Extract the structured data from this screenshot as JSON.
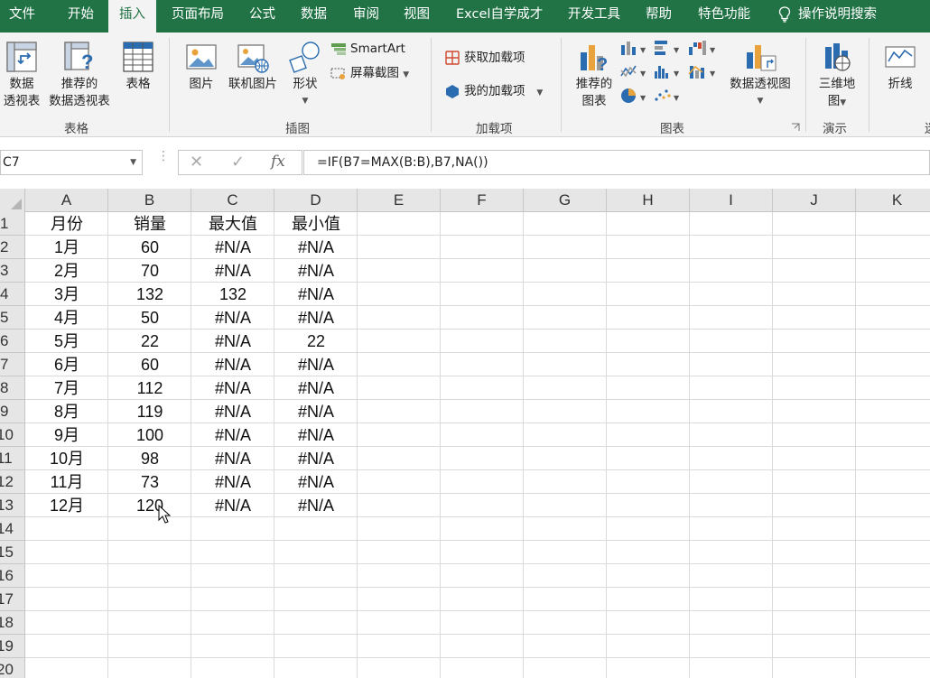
{
  "tabs": [
    {
      "label": "文件"
    },
    {
      "label": "开始"
    },
    {
      "label": "插入"
    },
    {
      "label": "页面布局"
    },
    {
      "label": "公式"
    },
    {
      "label": "数据"
    },
    {
      "label": "审阅"
    },
    {
      "label": "视图"
    },
    {
      "label": "Excel自学成才"
    },
    {
      "label": "开发工具"
    },
    {
      "label": "帮助"
    },
    {
      "label": "特色功能"
    },
    {
      "label": "操作说明搜索"
    }
  ],
  "active_tab": "插入",
  "ribbon": {
    "tables": {
      "pivot_line1": "数据",
      "pivot_line2": "透视表",
      "rec_pivot_line1": "推荐的",
      "rec_pivot_line2": "数据透视表",
      "table": "表格",
      "group": "表格"
    },
    "illustrations": {
      "pictures": "图片",
      "online_pictures": "联机图片",
      "shapes": "形状",
      "smartart": "SmartArt",
      "screenshot": "屏幕截图",
      "group": "插图"
    },
    "addins": {
      "get_addins": "获取加载项",
      "my_addins": "我的加载项",
      "group": "加载项"
    },
    "charts": {
      "rec_charts_line1": "推荐的",
      "rec_charts_line2": "图表",
      "pivot_chart": "数据透视图",
      "group": "图表"
    },
    "tours": {
      "map3d_line1": "三维地",
      "map3d_line2": "图",
      "group": "演示"
    },
    "sparklines": {
      "line": "折线",
      "group_partial": "迷"
    }
  },
  "formula_bar": {
    "name_box": "C7",
    "cancel_symbol": "✕",
    "enter_symbol": "✓",
    "fx_symbol": "fx",
    "formula": "=IF(B7=MAX(B:B),B7,NA())"
  },
  "columns": [
    "A",
    "B",
    "C",
    "D",
    "E",
    "F",
    "G",
    "H",
    "I",
    "J",
    "K"
  ],
  "row_numbers": [
    "1",
    "2",
    "3",
    "4",
    "5",
    "6",
    "7",
    "8",
    "9",
    "10",
    "11",
    "12",
    "13",
    "14",
    "15",
    "16",
    "17",
    "18",
    "19",
    "20"
  ],
  "sheet_rows": [
    [
      "月份",
      "销量",
      "最大值",
      "最小值"
    ],
    [
      "1月",
      "60",
      "#N/A",
      "#N/A"
    ],
    [
      "2月",
      "70",
      "#N/A",
      "#N/A"
    ],
    [
      "3月",
      "132",
      "132",
      "#N/A"
    ],
    [
      "4月",
      "50",
      "#N/A",
      "#N/A"
    ],
    [
      "5月",
      "22",
      "#N/A",
      "22"
    ],
    [
      "6月",
      "60",
      "#N/A",
      "#N/A"
    ],
    [
      "7月",
      "112",
      "#N/A",
      "#N/A"
    ],
    [
      "8月",
      "119",
      "#N/A",
      "#N/A"
    ],
    [
      "9月",
      "100",
      "#N/A",
      "#N/A"
    ],
    [
      "10月",
      "98",
      "#N/A",
      "#N/A"
    ],
    [
      "11月",
      "73",
      "#N/A",
      "#N/A"
    ],
    [
      "12月",
      "120",
      "#N/A",
      "#N/A"
    ]
  ],
  "colors": {
    "brand_green": "#217346",
    "ribbon_bg": "#f3f3f3",
    "header_bg": "#e6e6e6",
    "gridline": "#dadada"
  }
}
